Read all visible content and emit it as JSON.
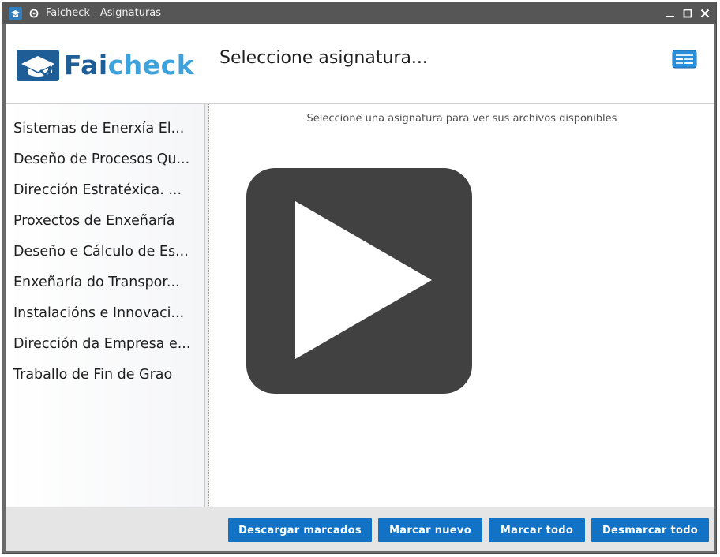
{
  "window": {
    "title": "Faicheck - Asignaturas",
    "icons": [
      "app-icon",
      "pin-icon",
      "minimize-icon",
      "maximize-icon",
      "close-icon"
    ]
  },
  "header": {
    "logo_part1": "Fai",
    "logo_part2": "check",
    "title": "Seleccione asignatura...",
    "corner_icon": "panel-icon"
  },
  "sidebar": {
    "items": [
      {
        "label": "Sistemas de Enerxía El..."
      },
      {
        "label": "Deseño de Procesos Qu..."
      },
      {
        "label": "Dirección Estratéxica. ..."
      },
      {
        "label": "Proxectos de Enxeñaría"
      },
      {
        "label": "Deseño e Cálculo de Es..."
      },
      {
        "label": "Enxeñaría do Transpor..."
      },
      {
        "label": "Instalacións e Innovaci..."
      },
      {
        "label": "Dirección da Empresa e..."
      },
      {
        "label": "Traballo de Fin de Grao"
      }
    ]
  },
  "main": {
    "hint": "Seleccione una asignatura para ver sus archivos disponibles",
    "overlay_icon": "play-icon"
  },
  "footer": {
    "download_marked": "Descargar marcados",
    "mark_new": "Marcar nuevo",
    "mark_all": "Marcar todo",
    "unmark_all": "Desmarcar todo"
  },
  "colors": {
    "accent": "#1273c6",
    "logo_dark": "#1f5d97",
    "logo_light": "#3ea2dd",
    "titlebar": "#565656"
  }
}
